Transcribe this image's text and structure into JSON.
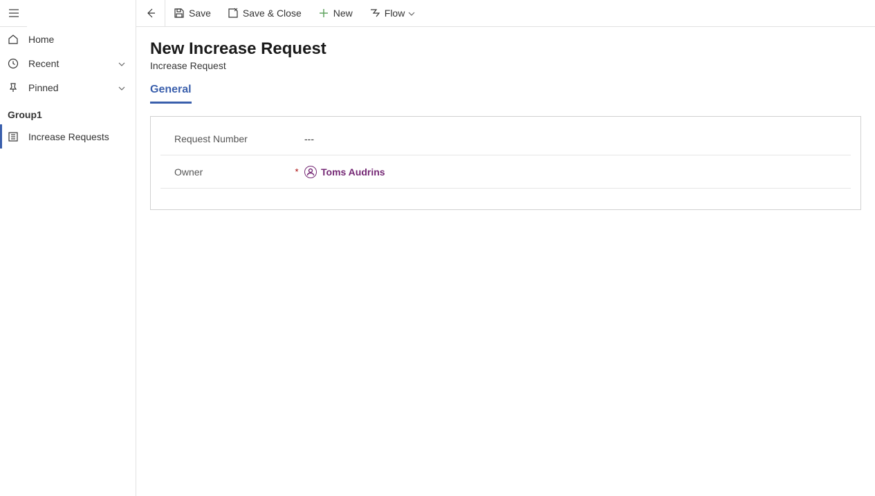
{
  "sidebar": {
    "items": [
      {
        "label": "Home",
        "icon": "home-icon",
        "expandable": false
      },
      {
        "label": "Recent",
        "icon": "clock-icon",
        "expandable": true
      },
      {
        "label": "Pinned",
        "icon": "pin-icon",
        "expandable": true
      }
    ],
    "group": {
      "header": "Group1",
      "items": [
        {
          "label": "Increase Requests",
          "icon": "list-icon",
          "active": true
        }
      ]
    }
  },
  "toolbar": {
    "save_label": "Save",
    "save_close_label": "Save & Close",
    "new_label": "New",
    "flow_label": "Flow"
  },
  "header": {
    "title": "New Increase Request",
    "subtitle": "Increase Request"
  },
  "tabs": {
    "general": "General"
  },
  "form": {
    "request_number": {
      "label": "Request Number",
      "value": "---",
      "required": false
    },
    "owner": {
      "label": "Owner",
      "required_mark": "*",
      "value": "Toms Audrins",
      "required": true
    }
  },
  "colors": {
    "accent": "#3a5fac",
    "owner_link": "#742774"
  }
}
